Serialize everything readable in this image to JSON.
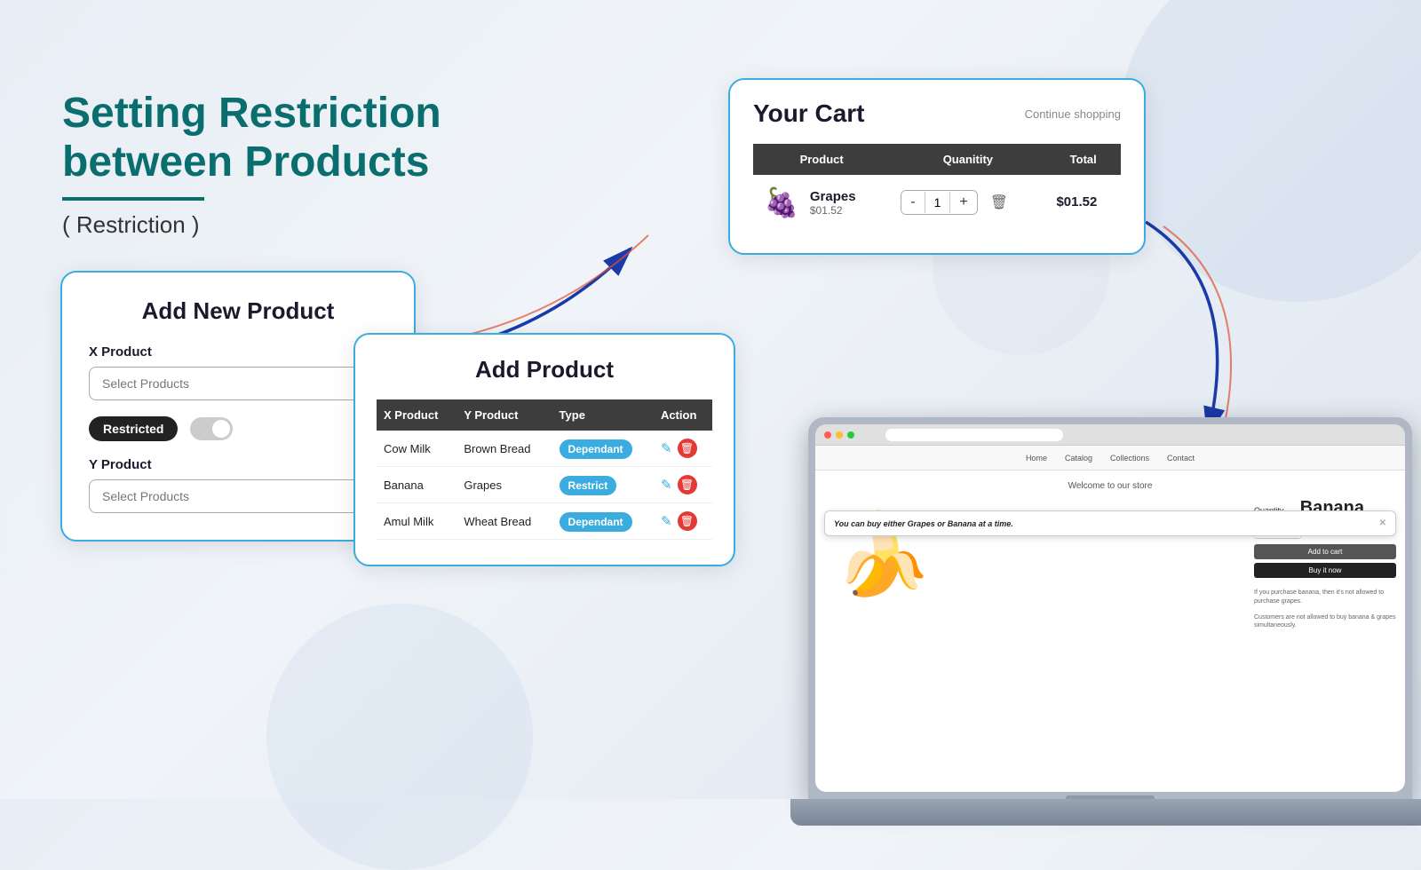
{
  "page": {
    "title": "Setting Restriction between Products",
    "subtitle": "( Restriction )",
    "background_color": "#e8eef5"
  },
  "heading": {
    "line1": "Setting Restriction",
    "line2": "between Products",
    "subtitle": "( Restriction )"
  },
  "add_new_product_card": {
    "title": "Add New Product",
    "x_product_label": "X Product",
    "x_product_placeholder": "Select Products",
    "restricted_label": "Restricted",
    "y_product_label": "Y Product",
    "y_product_placeholder": "Select Products"
  },
  "add_product_card": {
    "title": "Add Product",
    "table": {
      "headers": [
        "X Product",
        "Y Product",
        "Type",
        "Action"
      ],
      "rows": [
        {
          "x": "Cow Milk",
          "y": "Brown Bread",
          "type": "Dependant",
          "type_class": "dependant"
        },
        {
          "x": "Banana",
          "y": "Grapes",
          "type": "Restrict",
          "type_class": "restrict"
        },
        {
          "x": "Amul Milk",
          "y": "Wheat Bread",
          "type": "Dependant",
          "type_class": "dependant"
        }
      ]
    }
  },
  "cart_card": {
    "title": "Your Cart",
    "continue_shopping": "Continue shopping",
    "table": {
      "headers": [
        "Product",
        "Quanitity",
        "Total"
      ],
      "row": {
        "product_name": "Grapes",
        "product_price": "$01.52",
        "quantity": 1,
        "total": "$01.52",
        "fruit_emoji": "🍇"
      }
    }
  },
  "laptop": {
    "welcome_text": "Welcome to our store",
    "nav_items": [
      "Home",
      "Catalog",
      "Collections",
      "Contact"
    ],
    "product_title": "Banana",
    "banana_emoji": "🍌",
    "popup_text": "You can buy either Grapes or Banana at a time.",
    "qty_label": "Quantity",
    "add_to_cart": "Add to cart",
    "buy_now": "Buy it now",
    "note1": "If you purchase banana, then it's not allowed to purchase grapes.",
    "note2": "Customers are not allowed to buy banana & grapes simultaneously."
  },
  "colors": {
    "teal": "#0a6e6e",
    "blue_border": "#3aace0",
    "dark_header": "#3d3d3d",
    "badge_blue": "#3aace0",
    "delete_red": "#e53935",
    "text_dark": "#1a1a2e"
  }
}
